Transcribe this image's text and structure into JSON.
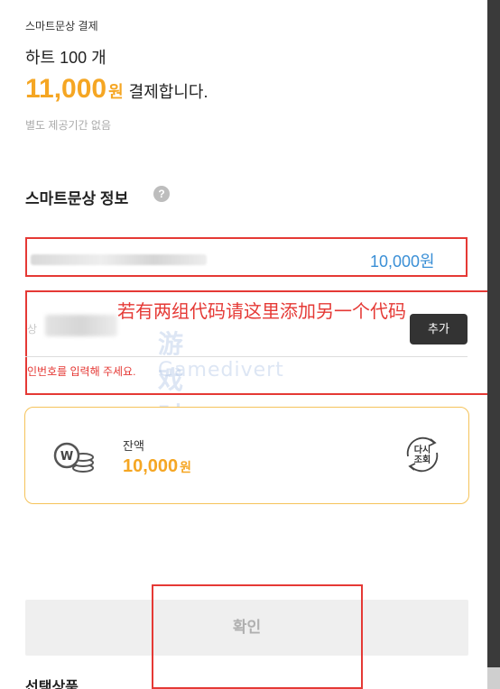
{
  "header": {
    "label": "스마트문상 결제"
  },
  "product": {
    "name": "하트 100 개"
  },
  "price": {
    "amount": "11,000",
    "unit": "원",
    "suffix": "결제합니다."
  },
  "notice": "별도 제공기간 없음",
  "info_section": {
    "title": "스마트문상 정보",
    "help_icon": "?"
  },
  "amount_row": {
    "value": "10,000원"
  },
  "code_input": {
    "placeholder_fragment": "상",
    "add_label": "추가",
    "error": "인번호를 입력해 주세요."
  },
  "annotation": "若有两组代码请这里添加另一个代码",
  "watermark": {
    "cn": "游戏时光",
    "en": "Gamedivert"
  },
  "balance": {
    "label": "잔액",
    "value": "10,000",
    "unit": "원",
    "refresh_label_top": "다시",
    "refresh_label_bottom": "조회"
  },
  "confirm": {
    "label": "확인"
  },
  "bottom_text": "선택상품",
  "colors": {
    "accent": "#f5a623",
    "link_blue": "#3a8fd6",
    "highlight_red": "#e53935"
  }
}
